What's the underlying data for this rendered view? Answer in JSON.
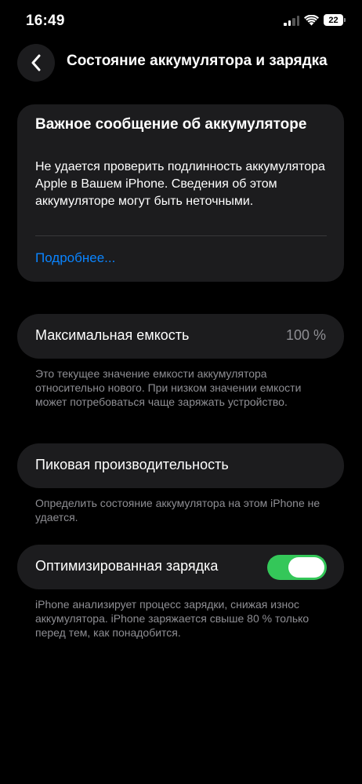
{
  "status_bar": {
    "time": "16:49",
    "battery_level": "22",
    "signal_bars_active": 2,
    "signal_bars_total": 4,
    "icons": [
      "cellular-signal-icon",
      "wifi-icon",
      "battery-icon"
    ]
  },
  "nav": {
    "title": "Состояние аккумулятора и зарядка",
    "back_icon": "chevron-left-icon"
  },
  "alert": {
    "title": "Важное сообщение об аккумуляторе",
    "body": "Не удается проверить подлинность аккумулятора Apple в Вашем iPhone. Сведения об этом аккумуляторе могут быть неточными.",
    "link": "Подробнее..."
  },
  "max_capacity": {
    "label": "Максимальная емкость",
    "value": "100 %",
    "footnote": "Это текущее значение емкости аккумулятора относительно нового. При низком значении емкости может потребоваться чаще заряжать устройство."
  },
  "peak_performance": {
    "label": "Пиковая производительность",
    "footnote": "Определить состояние аккумулятора на этом iPhone не удается."
  },
  "optimized_charging": {
    "label": "Оптимизированная зарядка",
    "enabled": true,
    "footnote": "iPhone анализирует процесс зарядки, снижая износ аккумулятора. iPhone заряжается свыше 80 % только перед тем, как понадобится."
  },
  "colors": {
    "background": "#000000",
    "card": "#1c1c1e",
    "link": "#0a84ff",
    "toggle_on": "#34c759",
    "secondary_text": "#8e8e93"
  }
}
